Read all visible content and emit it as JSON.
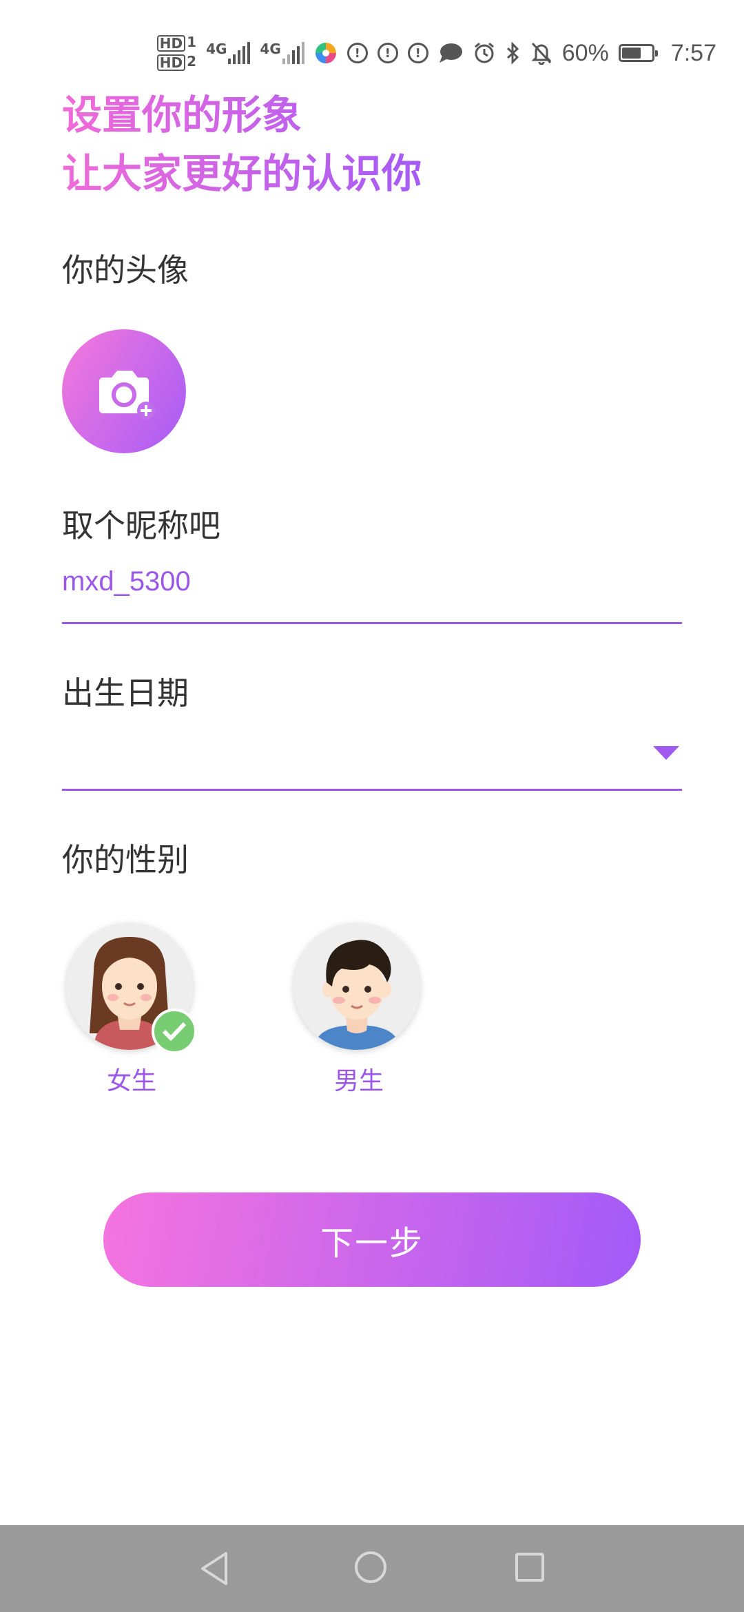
{
  "status_bar": {
    "hd1": "HD",
    "sim1": "1",
    "hd2": "HD",
    "sim2": "2",
    "net1": "4G",
    "net2": "4G",
    "battery_percent": "60%",
    "time": "7:57"
  },
  "headline": {
    "line1": "设置你的形象",
    "line2": "让大家更好的认识你"
  },
  "avatar_section": {
    "label": "你的头像"
  },
  "nickname_section": {
    "label": "取个昵称吧",
    "value": "mxd_5300"
  },
  "birthday_section": {
    "label": "出生日期",
    "value": ""
  },
  "gender_section": {
    "label": "你的性别",
    "options": [
      {
        "label": "女生",
        "selected": true
      },
      {
        "label": "男生",
        "selected": false
      }
    ]
  },
  "next_button": {
    "label": "下一步"
  },
  "colors": {
    "accent": "#9b57e8",
    "gradient_start": "#f574df",
    "gradient_end": "#a35af8",
    "check_green": "#78cc72"
  }
}
